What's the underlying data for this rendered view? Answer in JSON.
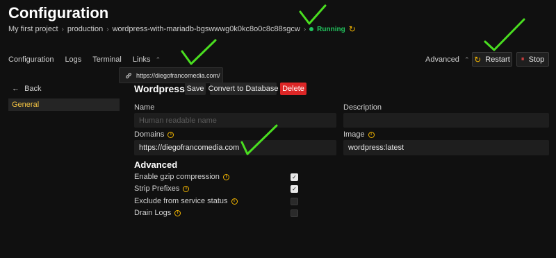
{
  "page": {
    "title": "Configuration",
    "breadcrumbs": [
      "My first project",
      "production",
      "wordpress-with-mariadb-bgswwwg0k0kc8o0c8c88sgcw"
    ],
    "status": "Running"
  },
  "topnav": {
    "items": [
      "Configuration",
      "Logs",
      "Terminal",
      "Links"
    ],
    "advanced_label": "Advanced",
    "restart_label": "Restart",
    "stop_label": "Stop"
  },
  "links_popup": {
    "url": "https://diegofrancomedia.com/"
  },
  "sidebar": {
    "back_label": "Back",
    "items": [
      {
        "label": "General",
        "active": true
      }
    ]
  },
  "main": {
    "section_title": "Wordpress",
    "buttons": {
      "save": "Save",
      "convert": "Convert to Database",
      "delete": "Delete"
    },
    "fields": {
      "name": {
        "label": "Name",
        "placeholder": "Human readable name",
        "value": ""
      },
      "description": {
        "label": "Description",
        "value": ""
      },
      "domains": {
        "label": "Domains",
        "value": "https://diegofrancomedia.com"
      },
      "image": {
        "label": "Image",
        "value": "wordpress:latest"
      }
    },
    "advanced": {
      "title": "Advanced",
      "options": [
        {
          "label": "Enable gzip compression",
          "checked": true,
          "symbol": "✓"
        },
        {
          "label": "Strip Prefixes",
          "checked": true,
          "symbol": "✓"
        },
        {
          "label": "Exclude from service status",
          "checked": false,
          "symbol": ""
        },
        {
          "label": "Drain Logs",
          "checked": false,
          "symbol": ""
        }
      ]
    }
  },
  "icons": {
    "chevron": "›",
    "dropdown": "⌃",
    "refresh": "↻",
    "back_arrow": "←",
    "restart": "↻",
    "stop": "⏸",
    "link": "🔗",
    "info": "i"
  },
  "colors": {
    "accent": "#f5b700",
    "running": "#22c55e",
    "delete": "#dc2626",
    "annotation": "#4ade20"
  }
}
